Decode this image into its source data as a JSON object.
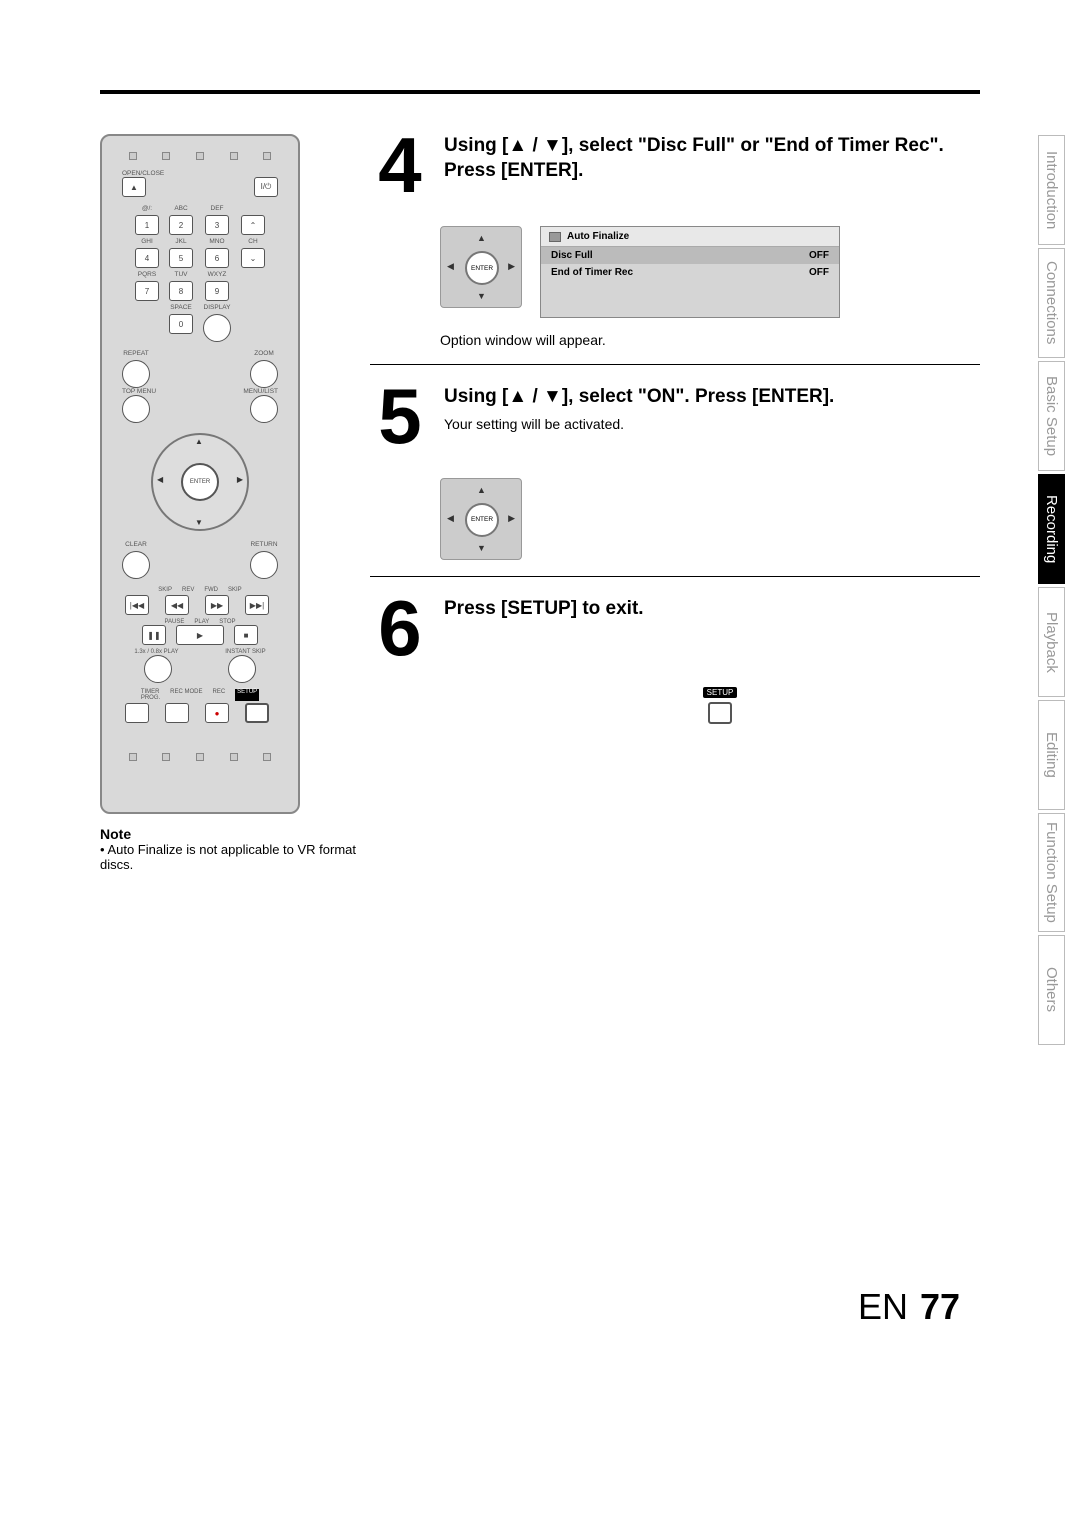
{
  "side_tabs": {
    "t1": "Introduction",
    "t2": "Connections",
    "t3": "Basic Setup",
    "t4": "Recording",
    "t5": "Playback",
    "t6": "Editing",
    "t7": "Function Setup",
    "t8": "Others"
  },
  "remote": {
    "open_close": "OPEN/CLOSE",
    "power": "I/⏻",
    "nums": {
      "n1": "1",
      "n2": "2",
      "n3": "3",
      "n4": "4",
      "n5": "5",
      "n6": "6",
      "n7": "7",
      "n8": "8",
      "n9": "9",
      "n0": "0"
    },
    "num_labels": {
      "l1": "@/:",
      "l2": "ABC",
      "l3": "DEF",
      "l4": "GHI",
      "l5": "JKL",
      "l6": "MNO",
      "l7": "PQRS",
      "l8": "TUV",
      "l9": "WXYZ",
      "l0": "SPACE"
    },
    "ch": "CH",
    "ch_up": "⌃",
    "ch_dn": "⌄",
    "display": "DISPLAY",
    "repeat": "REPEAT",
    "zoom": "ZOOM",
    "topmenu": "TOP MENU",
    "menulist": "MENU/LIST",
    "enter": "ENTER",
    "clear": "CLEAR",
    "return": "RETURN",
    "skip": "SKIP",
    "rev": "REV",
    "fwd": "FWD",
    "skip2": "SKIP",
    "pause": "PAUSE",
    "play": "PLAY",
    "stop": "STOP",
    "sp": "1.3x / 0.8x PLAY",
    "instant": "INSTANT SKIP",
    "timer": "TIMER\nPROG.",
    "recmode": "REC MODE",
    "rec": "REC",
    "setup": "SETUP"
  },
  "steps": {
    "s4": {
      "num": "4",
      "title_a": "Using [▲ / ▼], select \"Disc Full\" or \"End of Timer Rec\". Press [ENTER].",
      "after": "Option window will appear.",
      "osd_title": "Auto Finalize",
      "osd_r1a": "Disc Full",
      "osd_r1b": "OFF",
      "osd_r2a": "End of Timer Rec",
      "osd_r2b": "OFF",
      "enter": "ENTER"
    },
    "s5": {
      "num": "5",
      "title": "Using [▲ / ▼], select \"ON\". Press [ENTER].",
      "note": "Your setting will be activated.",
      "enter": "ENTER"
    },
    "s6": {
      "num": "6",
      "title": "Press [SETUP] to exit.",
      "setup": "SETUP"
    }
  },
  "note": {
    "head": "Note",
    "body": "• Auto Finalize is not applicable to VR format discs."
  },
  "footer": {
    "lang": "EN",
    "page": "77"
  }
}
